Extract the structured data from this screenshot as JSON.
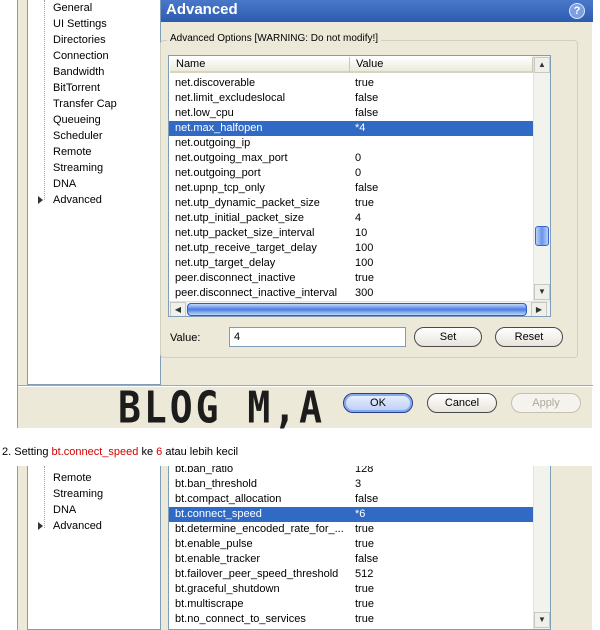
{
  "top_window": {
    "sidebar": {
      "items": [
        {
          "label": "General"
        },
        {
          "label": "UI Settings"
        },
        {
          "label": "Directories"
        },
        {
          "label": "Connection"
        },
        {
          "label": "Bandwidth"
        },
        {
          "label": "BitTorrent"
        },
        {
          "label": "Transfer Cap"
        },
        {
          "label": "Queueing"
        },
        {
          "label": "Scheduler"
        },
        {
          "label": "Remote"
        },
        {
          "label": "Streaming"
        },
        {
          "label": "DNA"
        },
        {
          "label": "Advanced"
        }
      ]
    },
    "header": {
      "title": "Advanced",
      "help_icon": "question-mark-icon"
    },
    "group_title": "Advanced Options [WARNING: Do not modify!]",
    "columns": {
      "name": "Name",
      "value": "Value"
    },
    "rows": [
      {
        "name": "net.discoverable",
        "value": "true",
        "selected": false
      },
      {
        "name": "net.limit_excludeslocal",
        "value": "false",
        "selected": false
      },
      {
        "name": "net.low_cpu",
        "value": "false",
        "selected": false
      },
      {
        "name": "net.max_halfopen",
        "value": "*4",
        "selected": true
      },
      {
        "name": "net.outgoing_ip",
        "value": "",
        "selected": false
      },
      {
        "name": "net.outgoing_max_port",
        "value": "0",
        "selected": false
      },
      {
        "name": "net.outgoing_port",
        "value": "0",
        "selected": false
      },
      {
        "name": "net.upnp_tcp_only",
        "value": "false",
        "selected": false
      },
      {
        "name": "net.utp_dynamic_packet_size",
        "value": "true",
        "selected": false
      },
      {
        "name": "net.utp_initial_packet_size",
        "value": "4",
        "selected": false
      },
      {
        "name": "net.utp_packet_size_interval",
        "value": "10",
        "selected": false
      },
      {
        "name": "net.utp_receive_target_delay",
        "value": "100",
        "selected": false
      },
      {
        "name": "net.utp_target_delay",
        "value": "100",
        "selected": false
      },
      {
        "name": "peer.disconnect_inactive",
        "value": "true",
        "selected": false
      },
      {
        "name": "peer.disconnect_inactive_interval",
        "value": "300",
        "selected": false
      }
    ],
    "value_label": "Value:",
    "value_input": "4",
    "buttons": {
      "set": "Set",
      "reset": "Reset",
      "ok": "OK",
      "cancel": "Cancel",
      "apply": "Apply"
    },
    "watermark": "BLOG M,A",
    "scroll_icons": {
      "up": "▲",
      "down": "▼",
      "left": "◀",
      "right": "▶"
    }
  },
  "caption": {
    "prefix": "2. Setting ",
    "setting": "bt.connect_speed",
    "middle": " ke ",
    "number": "6",
    "suffix": " atau lebih kecil"
  },
  "bottom_window": {
    "sidebar": {
      "items": [
        {
          "label": "Remote"
        },
        {
          "label": "Streaming"
        },
        {
          "label": "DNA"
        },
        {
          "label": "Advanced"
        }
      ]
    },
    "rows": [
      {
        "name": "bt.ban_ratio",
        "value": "128",
        "selected": false
      },
      {
        "name": "bt.ban_threshold",
        "value": "3",
        "selected": false
      },
      {
        "name": "bt.compact_allocation",
        "value": "false",
        "selected": false
      },
      {
        "name": "bt.connect_speed",
        "value": "*6",
        "selected": true
      },
      {
        "name": "bt.determine_encoded_rate_for_...",
        "value": "true",
        "selected": false
      },
      {
        "name": "bt.enable_pulse",
        "value": "true",
        "selected": false
      },
      {
        "name": "bt.enable_tracker",
        "value": "false",
        "selected": false
      },
      {
        "name": "bt.failover_peer_speed_threshold",
        "value": "512",
        "selected": false
      },
      {
        "name": "bt.graceful_shutdown",
        "value": "true",
        "selected": false
      },
      {
        "name": "bt.multiscrape",
        "value": "true",
        "selected": false
      },
      {
        "name": "bt.no_connect_to_services",
        "value": "true",
        "selected": false
      }
    ],
    "scroll_icons": {
      "down": "▼"
    }
  },
  "colors": {
    "selection": "#316ac5",
    "caption_accent": "#d40000",
    "header": "#2d5bb0"
  }
}
